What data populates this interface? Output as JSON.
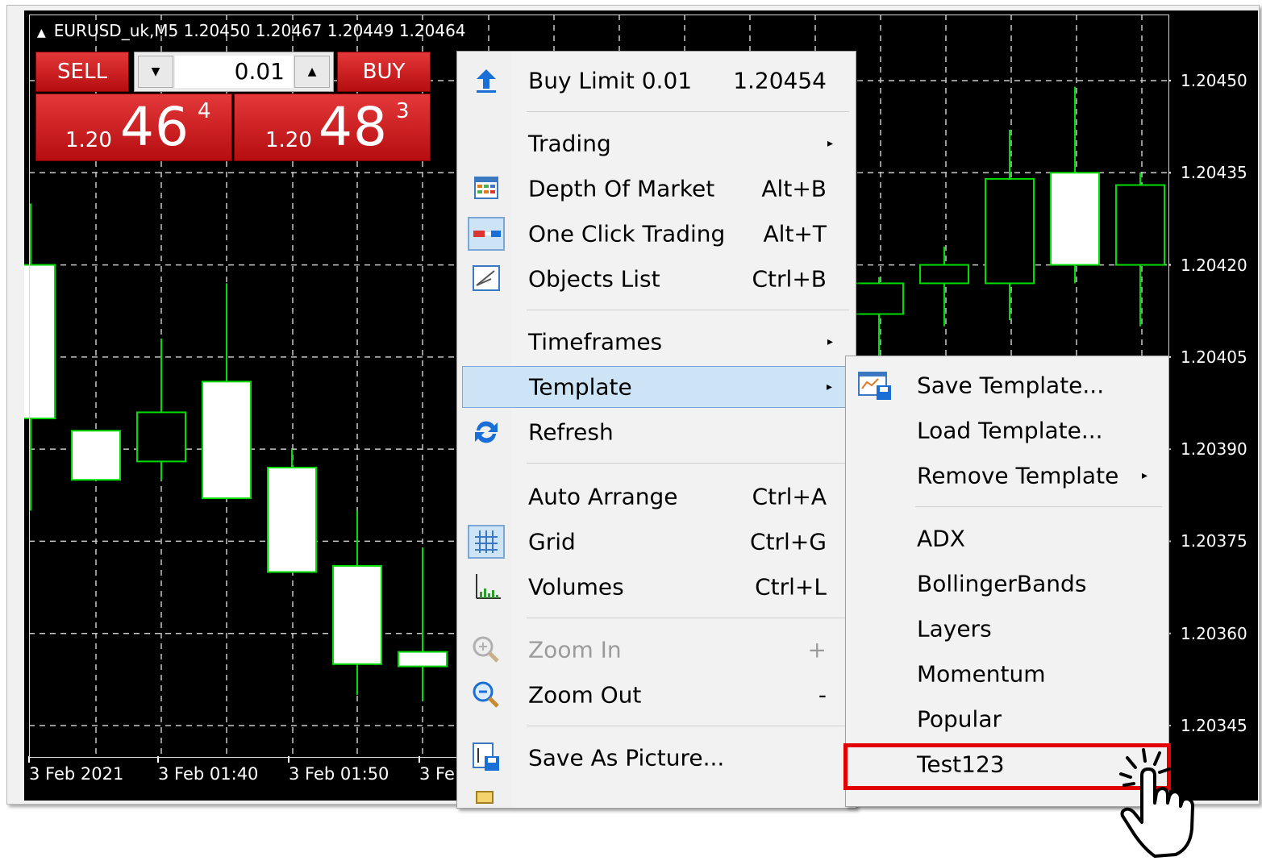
{
  "chart": {
    "title": "EURUSD_uk,M5  1.20450 1.20467 1.20449 1.20464",
    "price_axis": [
      "1.20450",
      "1.20435",
      "1.20420",
      "1.20405",
      "1.20390",
      "1.20375",
      "1.20360",
      "1.20345"
    ],
    "time_axis": [
      "3 Feb 2021",
      "3 Feb 01:40",
      "3 Feb 01:50",
      "3 Fe"
    ],
    "colors": {
      "background": "#000000",
      "candle_outline": "#00dd00",
      "bull_fill": "#000000",
      "bear_fill": "#ffffff",
      "grid": "#c8c8c8"
    }
  },
  "chart_data": {
    "type": "candlestick",
    "y_ticks": [
      1.2045,
      1.20435,
      1.2042,
      1.20405,
      1.2039,
      1.20375,
      1.2036,
      1.20345
    ],
    "candles": [
      {
        "open": 1.2042,
        "high": 1.2043,
        "low": 1.2038,
        "close": 1.20395,
        "fill": "white"
      },
      {
        "open": 1.20393,
        "high": 1.20393,
        "low": 1.20385,
        "close": 1.20385,
        "fill": "white"
      },
      {
        "open": 1.20388,
        "high": 1.20408,
        "low": 1.20385,
        "close": 1.20396,
        "fill": "black"
      },
      {
        "open": 1.20401,
        "high": 1.20417,
        "low": 1.20382,
        "close": 1.20382,
        "fill": "white"
      },
      {
        "open": 1.20387,
        "high": 1.2039,
        "low": 1.2037,
        "close": 1.2037,
        "fill": "white"
      },
      {
        "open": 1.20371,
        "high": 1.2038,
        "low": 1.2035,
        "close": 1.20355,
        "fill": "white"
      },
      {
        "open": 1.20357,
        "high": 1.20374,
        "low": 1.20349,
        "close": 1.20355,
        "fill": "white"
      },
      {
        "open": 1.20412,
        "high": 1.20418,
        "low": 1.204,
        "close": 1.20417,
        "fill": "black"
      },
      {
        "open": 1.20417,
        "high": 1.20423,
        "low": 1.2041,
        "close": 1.2042,
        "fill": "black"
      },
      {
        "open": 1.20417,
        "high": 1.20442,
        "low": 1.20411,
        "close": 1.20434,
        "fill": "black"
      },
      {
        "open": 1.2042,
        "high": 1.20449,
        "low": 1.20417,
        "close": 1.20435,
        "fill": "white"
      },
      {
        "open": 1.2042,
        "high": 1.20435,
        "low": 1.2041,
        "close": 1.20433,
        "fill": "black"
      }
    ]
  },
  "one_click": {
    "sell_label": "SELL",
    "buy_label": "BUY",
    "lot": "0.01",
    "lot_dec": "▼",
    "lot_inc": "▲",
    "sell_price": {
      "prefix": "1.20",
      "big": "46",
      "sup": "4"
    },
    "buy_price": {
      "prefix": "1.20",
      "big": "48",
      "sup": "3"
    }
  },
  "menu": {
    "items": [
      {
        "label": "Buy Limit 0.01",
        "shortcut": "1.20454",
        "icon": "buy-limit-arrow-icon"
      },
      {
        "label": "Trading",
        "arrow": "▸"
      },
      {
        "label": "Depth Of Market",
        "shortcut": "Alt+B",
        "icon": "depth-of-market-icon"
      },
      {
        "label": "One Click Trading",
        "shortcut": "Alt+T",
        "icon": "one-click-trading-icon"
      },
      {
        "label": "Objects List",
        "shortcut": "Ctrl+B",
        "icon": "objects-list-icon"
      },
      {
        "label": "Timeframes",
        "arrow": "▸"
      },
      {
        "label": "Template",
        "arrow": "▸"
      },
      {
        "label": "Refresh",
        "icon": "refresh-icon"
      },
      {
        "label": "Auto Arrange",
        "shortcut": "Ctrl+A"
      },
      {
        "label": "Grid",
        "shortcut": "Ctrl+G",
        "icon": "grid-icon"
      },
      {
        "label": "Volumes",
        "shortcut": "Ctrl+L",
        "icon": "volumes-icon"
      },
      {
        "label": "Zoom In",
        "shortcut": "+",
        "icon": "zoom-in-icon"
      },
      {
        "label": "Zoom Out",
        "shortcut": "-",
        "icon": "zoom-out-icon"
      },
      {
        "label": "Save As Picture...",
        "icon": "save-picture-icon"
      }
    ]
  },
  "submenu": {
    "items": [
      {
        "label": "Save Template...",
        "icon": "save-template-icon"
      },
      {
        "label": "Load Template..."
      },
      {
        "label": "Remove Template",
        "arrow": "▸"
      },
      {
        "label": "ADX"
      },
      {
        "label": "BollingerBands"
      },
      {
        "label": "Layers"
      },
      {
        "label": "Momentum"
      },
      {
        "label": "Popular"
      },
      {
        "label": "Test123"
      }
    ],
    "highlight_color": "#e30000"
  }
}
